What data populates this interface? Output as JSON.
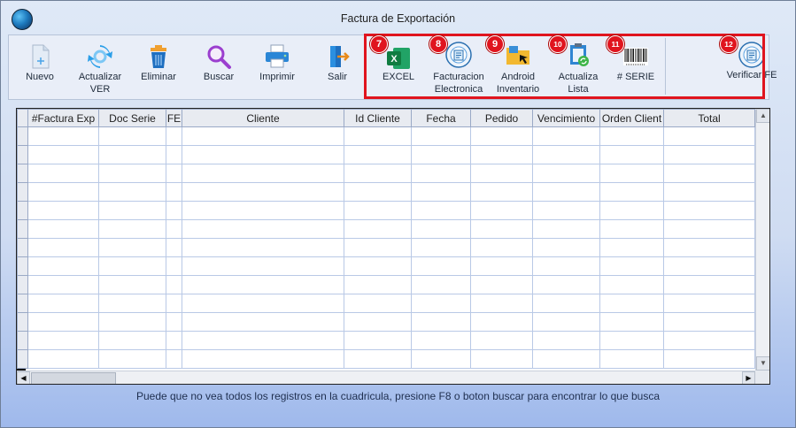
{
  "window": {
    "title": "Factura de Exportación"
  },
  "toolbar": {
    "buttons": [
      {
        "label": "Nuevo",
        "icon": "new-document-icon"
      },
      {
        "label": "Actualizar\nVER",
        "icon": "refresh-icon"
      },
      {
        "label": "Eliminar",
        "icon": "trash-icon"
      },
      {
        "label": "Buscar",
        "icon": "magnifier-icon"
      },
      {
        "label": "Imprimir",
        "icon": "printer-icon"
      },
      {
        "label": "Salir",
        "icon": "exit-door-icon"
      },
      {
        "label": "EXCEL",
        "icon": "excel-icon",
        "badge": "7"
      },
      {
        "label": "Facturacion\nElectronica",
        "icon": "e-invoice-seal-icon",
        "badge": "8"
      },
      {
        "label": "Android\nInventario",
        "icon": "folder-pointer-icon",
        "badge": "9"
      },
      {
        "label": "Actualiza\nLista",
        "icon": "clipboard-refresh-icon",
        "badge": "10"
      },
      {
        "label": "# SERIE",
        "icon": "barcode-icon",
        "badge": "11"
      },
      {
        "label": "Verificar FE",
        "icon": "e-invoice-seal-icon",
        "badge": "12"
      }
    ]
  },
  "grid": {
    "columns": [
      "#Factura Exp",
      "Doc Serie",
      "FE",
      "Cliente",
      "Id Cliente",
      "Fecha",
      "Pedido",
      "Vencimiento",
      "Orden Client",
      "Total"
    ],
    "empty_rows": 13
  },
  "status": {
    "hint": "Puede que no vea todos los registros en la cuadricula, presione F8 o boton buscar para encontrar lo que busca"
  },
  "colors": {
    "highlight": "#e0141e",
    "accent": "#1e7bbf"
  }
}
